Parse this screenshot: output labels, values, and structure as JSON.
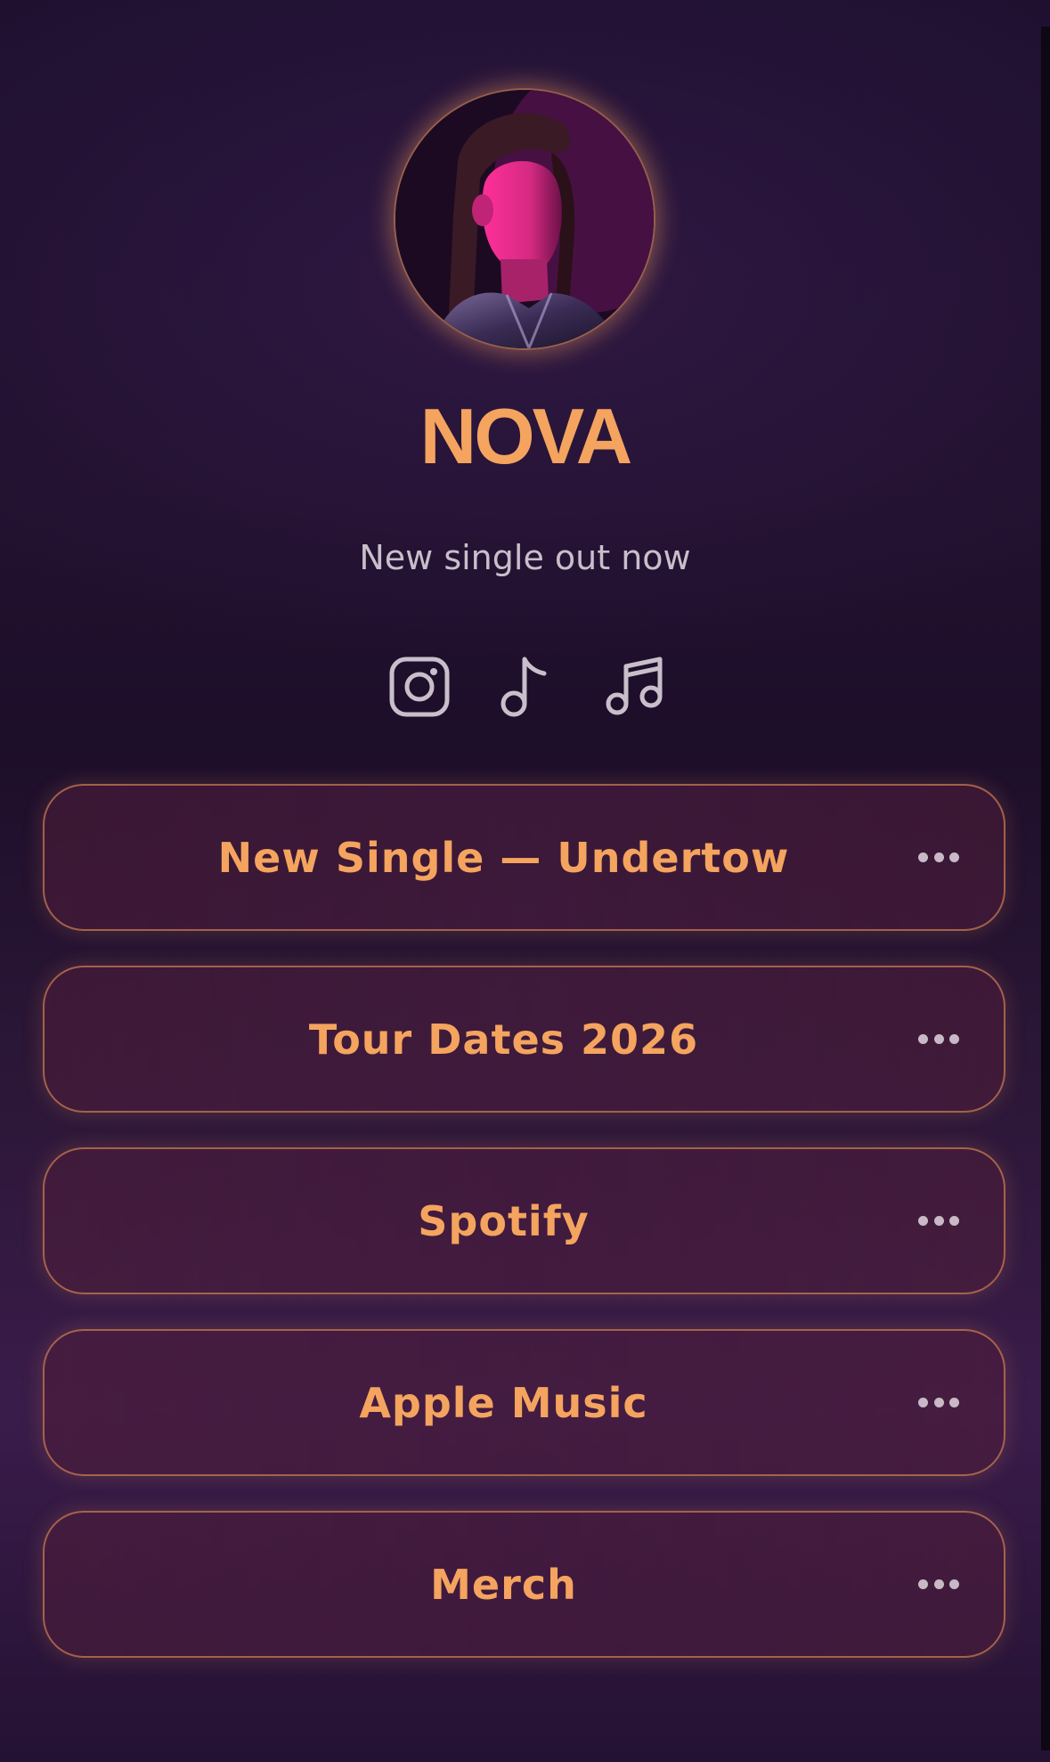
{
  "profile": {
    "name": "NOVA",
    "tagline": "New single out now",
    "avatar_alt": "Artist portrait"
  },
  "socials": [
    {
      "icon": "instagram-icon"
    },
    {
      "icon": "tiktok-icon"
    },
    {
      "icon": "music-notes-icon"
    }
  ],
  "links": [
    {
      "label": "New Single — Undertow"
    },
    {
      "label": "Tour Dates 2026"
    },
    {
      "label": "Spotify"
    },
    {
      "label": "Apple Music"
    },
    {
      "label": "Merch"
    }
  ],
  "colors": {
    "accent": "#f4a45e",
    "text_muted": "#c8bfca",
    "background_top": "#1f1030",
    "background_bottom": "#3a1c4a",
    "button_border": "#d08054"
  }
}
